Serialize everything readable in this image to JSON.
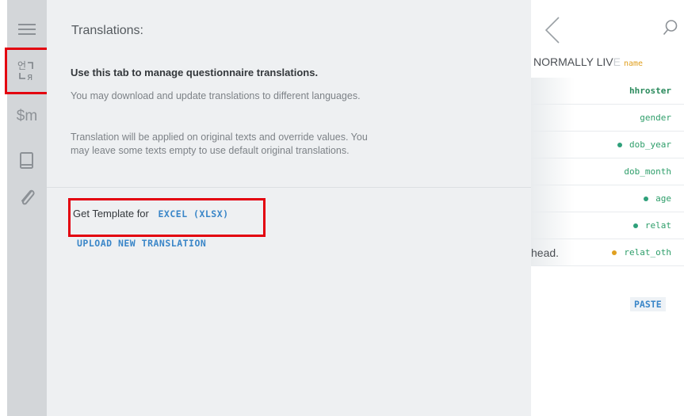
{
  "sidebar": {
    "icons": [
      "menu-icon",
      "translate-icon",
      "macros-icon",
      "book-icon",
      "paperclip-icon"
    ],
    "macros_label": "$m"
  },
  "translations": {
    "title": "Translations:",
    "intro": "Use this tab to manage questionnaire translations.",
    "para1": "You may download and update translations to different languages.",
    "para2": "Translation will be applied on original texts and override values. You may leave some texts empty to use default original translations.",
    "template_label": "Get Template for",
    "excel_link": "EXCEL (XLSX)",
    "upload_link": "UPLOAD NEW TRANSLATION"
  },
  "right_panel": {
    "header_text": "NORMALLY LIV",
    "header_faded": "E",
    "header_var": "name",
    "variables": [
      {
        "name": "hhroster",
        "dot": "",
        "bold": true,
        "left_text": ""
      },
      {
        "name": "gender",
        "dot": "",
        "bold": false,
        "left_text": ""
      },
      {
        "name": "dob_year",
        "dot": "green",
        "bold": false,
        "left_text": ""
      },
      {
        "name": "dob_month",
        "dot": "",
        "bold": false,
        "left_text": ""
      },
      {
        "name": "age",
        "dot": "green",
        "bold": false,
        "left_text": ""
      },
      {
        "name": "relat",
        "dot": "green",
        "bold": false,
        "left_text": ""
      },
      {
        "name": "relat_oth",
        "dot": "orange",
        "bold": false,
        "left_text": "head."
      }
    ],
    "paste_label": "PASTE"
  },
  "colors": {
    "accent": "#3a86c8",
    "highlight": "#e3000f",
    "variable_green": "#2e9e6a"
  }
}
